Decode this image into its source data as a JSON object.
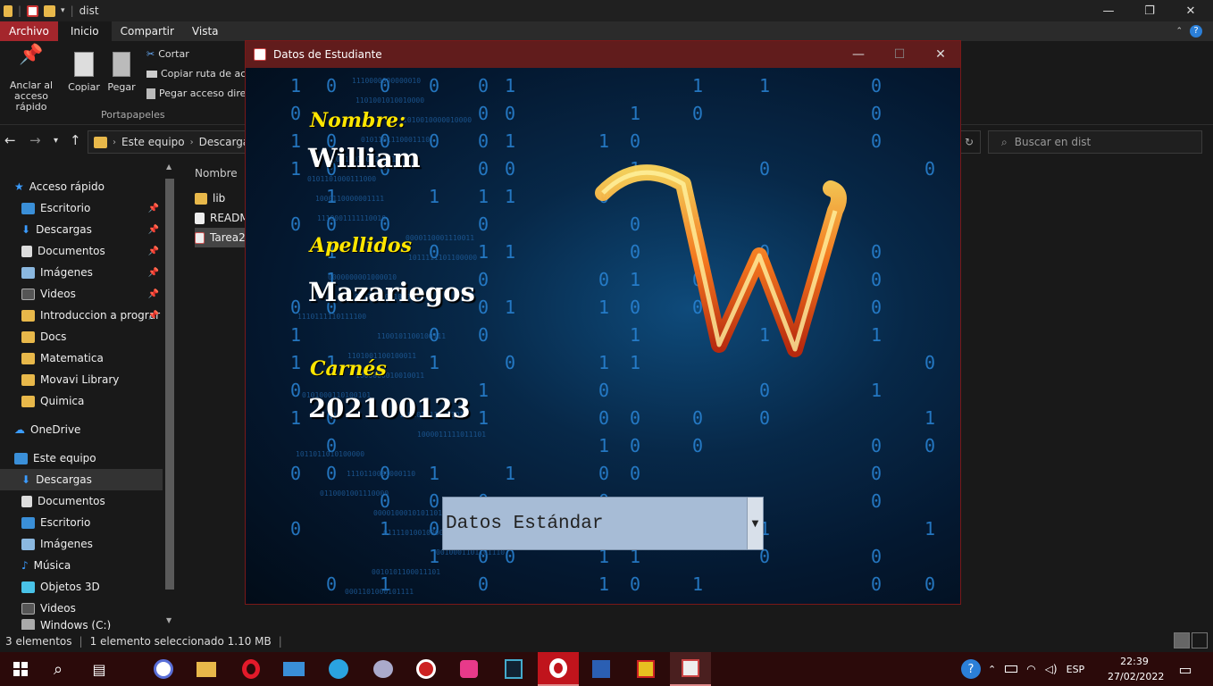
{
  "explorer": {
    "window_title": "dist",
    "ribbon_tabs": [
      "Archivo",
      "Inicio",
      "Compartir",
      "Vista"
    ],
    "ribbon": {
      "anclar": "Anclar al acceso rápido",
      "copiar": "Copiar",
      "pegar": "Pegar",
      "cortar": "Cortar",
      "copiar_ruta": "Copiar ruta de acc",
      "pegar_acceso": "Pegar acceso direc",
      "group_label": "Portapapeles"
    },
    "address": {
      "crumbs": [
        "Este equipo",
        "Descargas"
      ],
      "search_placeholder": "Buscar en dist"
    },
    "nav": {
      "quick_access": "Acceso rápido",
      "quick_items": [
        "Escritorio",
        "Descargas",
        "Documentos",
        "Imágenes",
        "Videos",
        "Introduccion a prograr",
        "Docs",
        "Matematica",
        "Movavi Library",
        "Quimica"
      ],
      "onedrive": "OneDrive",
      "this_pc": "Este equipo",
      "pc_items": [
        "Descargas",
        "Documentos",
        "Escritorio",
        "Imágenes",
        "Música",
        "Objetos 3D",
        "Videos",
        "Windows (C:)"
      ]
    },
    "files": {
      "column_name": "Nombre",
      "items": [
        "lib",
        "READM",
        "Tarea2"
      ]
    },
    "status": {
      "count": "3 elementos",
      "selection": "1 elemento seleccionado  1.10 MB"
    }
  },
  "student_window": {
    "title": "Datos de Estudiante",
    "labels": {
      "nombre": "Nombre:",
      "apellidos": "Apellidos",
      "carne": "Carnés"
    },
    "values": {
      "nombre": "William",
      "apellidos": "Mazariegos",
      "carne": "202100123"
    },
    "combo_selected": "Datos Estándar"
  },
  "taskbar": {
    "lang": "ESP",
    "time": "22:39",
    "date": "27/02/2022"
  },
  "colors": {
    "accent_red": "#a4262c",
    "label_yellow": "#ffe600",
    "digit_blue": "#2a86d8"
  }
}
